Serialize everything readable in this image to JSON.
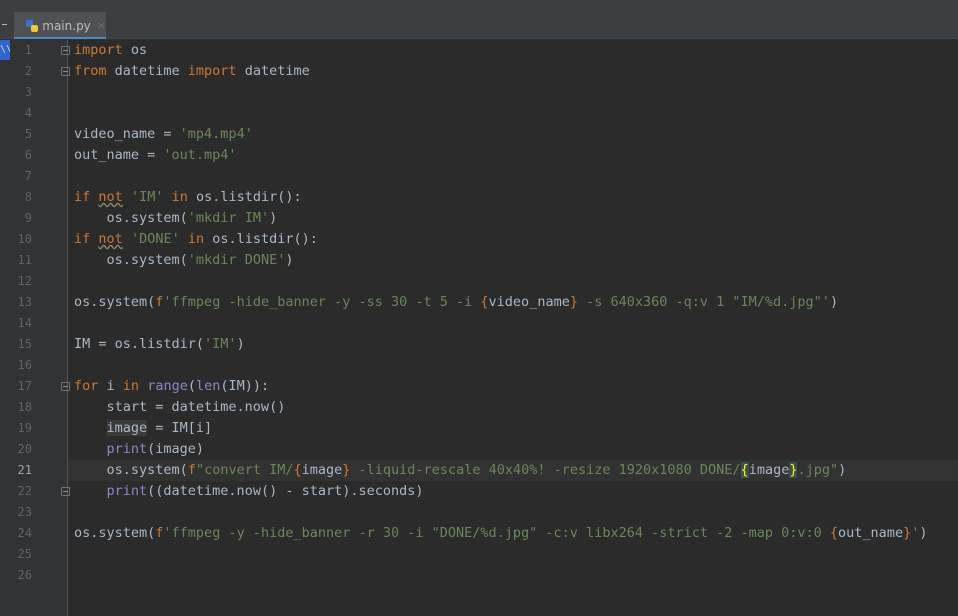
{
  "tab": {
    "filename": "main.py",
    "close_glyph": "×"
  },
  "sidebar": {
    "selected_fragment": "\\\\"
  },
  "editor": {
    "current_line": 21,
    "lines": [
      {
        "n": "1",
        "text": "import os"
      },
      {
        "n": "2",
        "text": "from datetime import datetime"
      },
      {
        "n": "3",
        "text": ""
      },
      {
        "n": "4",
        "text": ""
      },
      {
        "n": "5",
        "text": "video_name = 'mp4.mp4'"
      },
      {
        "n": "6",
        "text": "out_name = 'out.mp4'"
      },
      {
        "n": "7",
        "text": ""
      },
      {
        "n": "8",
        "text": "if not 'IM' in os.listdir():"
      },
      {
        "n": "9",
        "text": "    os.system('mkdir IM')"
      },
      {
        "n": "10",
        "text": "if not 'DONE' in os.listdir():"
      },
      {
        "n": "11",
        "text": "    os.system('mkdir DONE')"
      },
      {
        "n": "12",
        "text": ""
      },
      {
        "n": "13",
        "text": "os.system(f'ffmpeg -hide_banner -y -ss 30 -t 5 -i {video_name} -s 640x360 -q:v 1 \"IM/%d.jpg\"')"
      },
      {
        "n": "14",
        "text": ""
      },
      {
        "n": "15",
        "text": "IM = os.listdir('IM')"
      },
      {
        "n": "16",
        "text": ""
      },
      {
        "n": "17",
        "text": "for i in range(len(IM)):"
      },
      {
        "n": "18",
        "text": "    start = datetime.now()"
      },
      {
        "n": "19",
        "text": "    image = IM[i]"
      },
      {
        "n": "20",
        "text": "    print(image)"
      },
      {
        "n": "21",
        "text": "    os.system(f\"convert IM/{image} -liquid-rescale 40x40%! -resize 1920x1080 DONE/{image}.jpg\")"
      },
      {
        "n": "22",
        "text": "    print((datetime.now() - start).seconds)"
      },
      {
        "n": "23",
        "text": ""
      },
      {
        "n": "24",
        "text": "os.system(f'ffmpeg -y -hide_banner -r 30 -i \"DONE/%d.jpg\" -c:v libx264 -strict -2 -map 0:v:0 {out_name}')"
      },
      {
        "n": "25",
        "text": ""
      },
      {
        "n": "26",
        "text": ""
      }
    ]
  },
  "colors": {
    "background": "#2b2b2b",
    "keyword": "#cc7832",
    "string": "#6a8759",
    "builtin": "#8888c6",
    "text": "#a9b7c6",
    "tab_underline": "#4a88c7"
  }
}
